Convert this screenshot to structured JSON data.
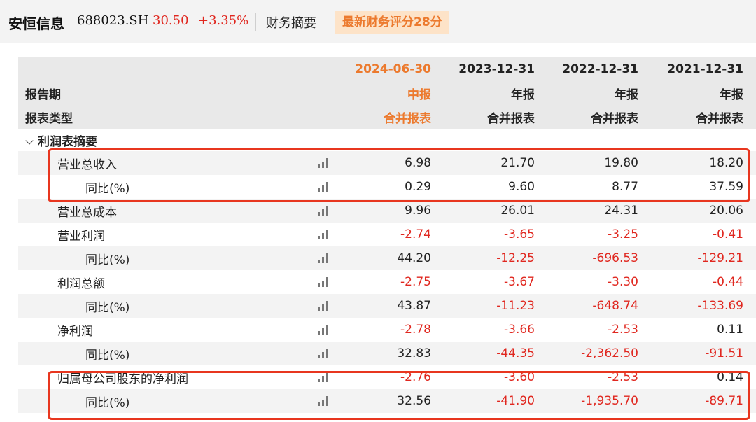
{
  "header": {
    "stock_name": "安恒信息",
    "stock_code": "688023.SH",
    "price": "30.50",
    "change": "+3.35%",
    "section": "财务摘要",
    "score_badge": "最新财务评分28分"
  },
  "table": {
    "row_labels": {
      "period": "报告期",
      "type": "报表类型"
    },
    "columns": [
      {
        "date": "2024-06-30",
        "period": "中报",
        "type": "合并报表"
      },
      {
        "date": "2023-12-31",
        "period": "年报",
        "type": "合并报表"
      },
      {
        "date": "2022-12-31",
        "period": "年报",
        "type": "合并报表"
      },
      {
        "date": "2021-12-31",
        "period": "年报",
        "type": "合并报表"
      }
    ],
    "section_title": "利润表摘要",
    "rows": [
      {
        "label": "营业总收入",
        "indent": false,
        "values": [
          "6.98",
          "21.70",
          "19.80",
          "18.20"
        ]
      },
      {
        "label": "同比(%)",
        "indent": true,
        "values": [
          "0.29",
          "9.60",
          "8.77",
          "37.59"
        ]
      },
      {
        "label": "营业总成本",
        "indent": false,
        "values": [
          "9.96",
          "26.01",
          "24.31",
          "20.06"
        ]
      },
      {
        "label": "营业利润",
        "indent": false,
        "values": [
          "-2.74",
          "-3.65",
          "-3.25",
          "-0.41"
        ]
      },
      {
        "label": "同比(%)",
        "indent": true,
        "values": [
          "44.20",
          "-12.25",
          "-696.53",
          "-129.21"
        ]
      },
      {
        "label": "利润总额",
        "indent": false,
        "values": [
          "-2.75",
          "-3.67",
          "-3.30",
          "-0.44"
        ]
      },
      {
        "label": "同比(%)",
        "indent": true,
        "values": [
          "43.87",
          "-11.23",
          "-648.74",
          "-133.69"
        ]
      },
      {
        "label": "净利润",
        "indent": false,
        "values": [
          "-2.78",
          "-3.66",
          "-2.53",
          "0.11"
        ]
      },
      {
        "label": "同比(%)",
        "indent": true,
        "values": [
          "32.83",
          "-44.35",
          "-2,362.50",
          "-91.51"
        ]
      },
      {
        "label": "归属母公司股东的净利润",
        "indent": false,
        "values": [
          "-2.76",
          "-3.60",
          "-2.53",
          "0.14"
        ]
      },
      {
        "label": "同比(%)",
        "indent": true,
        "values": [
          "32.56",
          "-41.90",
          "-1,935.70",
          "-89.71"
        ]
      }
    ]
  },
  "colors": {
    "negative": "#e0271f",
    "current_period": "#ec7a2e",
    "highlight_box": "#e8361f"
  },
  "icons": {
    "row_chart": "bar-chart-icon",
    "section_toggle": "chevron-down-icon"
  }
}
